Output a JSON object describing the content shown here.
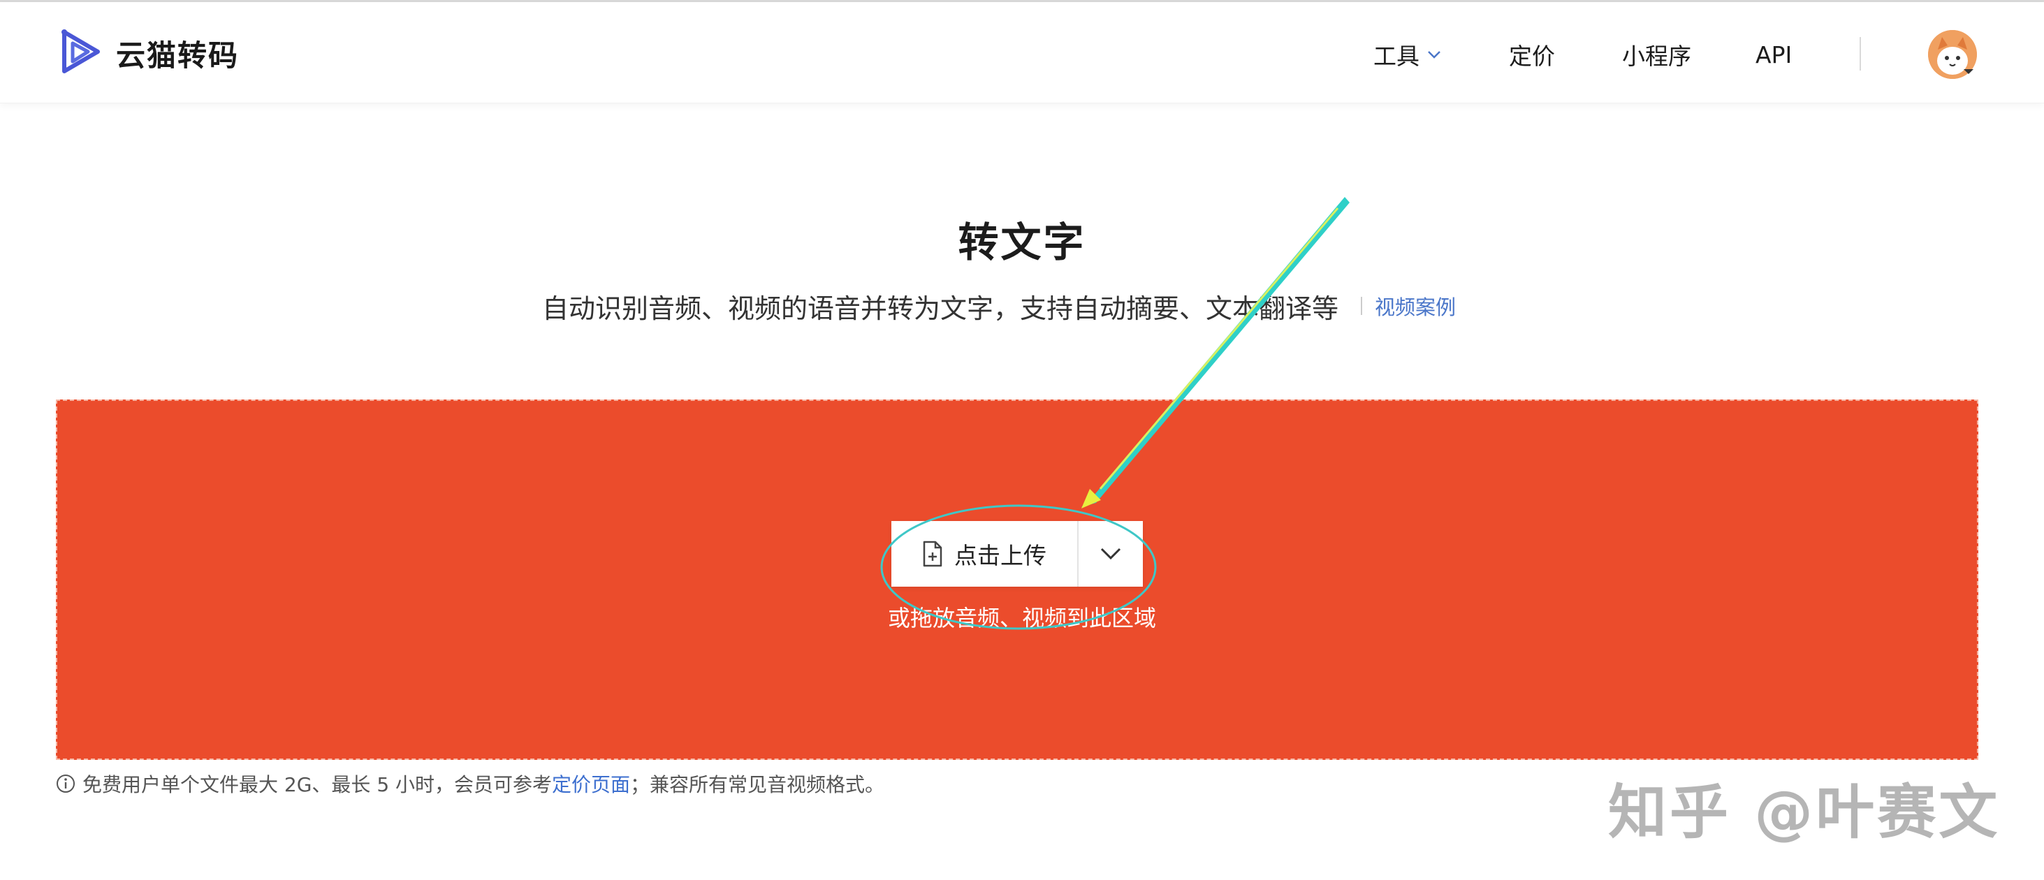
{
  "brand": {
    "name": "云猫转码",
    "accent": "#4a57d6"
  },
  "nav": {
    "items": [
      {
        "label": "工具",
        "has_dropdown": true
      },
      {
        "label": "定价"
      },
      {
        "label": "小程序"
      },
      {
        "label": "API"
      }
    ]
  },
  "hero": {
    "title": "转文字",
    "subtitle": "自动识别音频、视频的语音并转为文字，支持自动摘要、文本翻译等",
    "video_link": "视频案例"
  },
  "upload": {
    "button_label": "点击上传",
    "drop_hint": "或拖放音频、视频到此区域",
    "zone_color": "#eb4c2c"
  },
  "footnote": {
    "prefix": "免费用户单个文件最大 2G、最长 5 小时，会员可参考",
    "link": "定价页面",
    "suffix": "；兼容所有常见音视频格式。"
  },
  "watermark": "知乎 @叶赛文",
  "icons": {
    "logo": "logo-icon",
    "dropdown": "chevron-down-icon",
    "file": "file-add-icon",
    "info": "info-icon"
  }
}
